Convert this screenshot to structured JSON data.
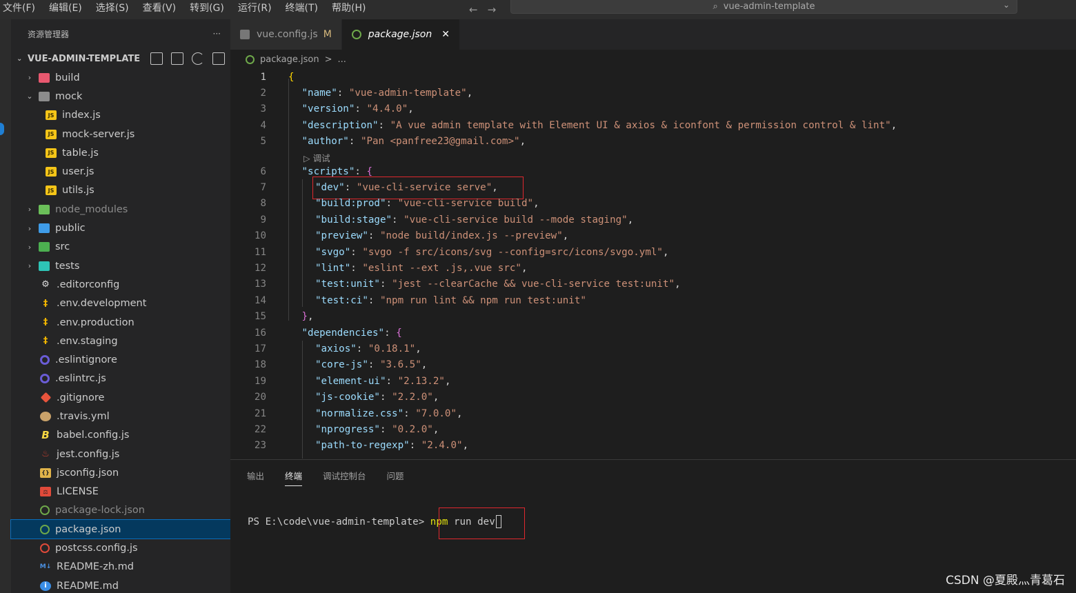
{
  "menubar": {
    "items": [
      "文件(F)",
      "编辑(E)",
      "选择(S)",
      "查看(V)",
      "转到(G)",
      "运行(R)",
      "终端(T)",
      "帮助(H)"
    ],
    "search_text": "vue-admin-template"
  },
  "sidebar": {
    "header": "资源管理器",
    "more": "···",
    "project": "VUE-ADMIN-TEMPLATE",
    "tree": [
      {
        "label": "build",
        "type": "folder",
        "expanded": false,
        "level": 0,
        "icon": "folder-red"
      },
      {
        "label": "mock",
        "type": "folder",
        "expanded": true,
        "level": 0,
        "icon": "folder-grey"
      },
      {
        "label": "index.js",
        "type": "file",
        "level": 1,
        "icon": "js"
      },
      {
        "label": "mock-server.js",
        "type": "file",
        "level": 1,
        "icon": "js"
      },
      {
        "label": "table.js",
        "type": "file",
        "level": 1,
        "icon": "js"
      },
      {
        "label": "user.js",
        "type": "file",
        "level": 1,
        "icon": "js"
      },
      {
        "label": "utils.js",
        "type": "file",
        "level": 1,
        "icon": "js"
      },
      {
        "label": "node_modules",
        "type": "folder",
        "expanded": false,
        "level": 0,
        "icon": "folder-green",
        "dim": true
      },
      {
        "label": "public",
        "type": "folder",
        "expanded": false,
        "level": 0,
        "icon": "folder-blue"
      },
      {
        "label": "src",
        "type": "folder",
        "expanded": false,
        "level": 0,
        "icon": "folder-src"
      },
      {
        "label": "tests",
        "type": "folder",
        "expanded": false,
        "level": 0,
        "icon": "folder-tests"
      },
      {
        "label": ".editorconfig",
        "type": "file",
        "level": 0,
        "icon": "gear"
      },
      {
        "label": ".env.development",
        "type": "file",
        "level": 0,
        "icon": "env"
      },
      {
        "label": ".env.production",
        "type": "file",
        "level": 0,
        "icon": "env"
      },
      {
        "label": ".env.staging",
        "type": "file",
        "level": 0,
        "icon": "env"
      },
      {
        "label": ".eslintignore",
        "type": "file",
        "level": 0,
        "icon": "eslint"
      },
      {
        "label": ".eslintrc.js",
        "type": "file",
        "level": 0,
        "icon": "eslint"
      },
      {
        "label": ".gitignore",
        "type": "file",
        "level": 0,
        "icon": "git"
      },
      {
        "label": ".travis.yml",
        "type": "file",
        "level": 0,
        "icon": "travis"
      },
      {
        "label": "babel.config.js",
        "type": "file",
        "level": 0,
        "icon": "babel"
      },
      {
        "label": "jest.config.js",
        "type": "file",
        "level": 0,
        "icon": "jest"
      },
      {
        "label": "jsconfig.json",
        "type": "file",
        "level": 0,
        "icon": "jsonc"
      },
      {
        "label": "LICENSE",
        "type": "file",
        "level": 0,
        "icon": "license"
      },
      {
        "label": "package-lock.json",
        "type": "file",
        "level": 0,
        "icon": "node",
        "dim": true
      },
      {
        "label": "package.json",
        "type": "file",
        "level": 0,
        "icon": "node",
        "active": true
      },
      {
        "label": "postcss.config.js",
        "type": "file",
        "level": 0,
        "icon": "postcss"
      },
      {
        "label": "README-zh.md",
        "type": "file",
        "level": 0,
        "icon": "md"
      },
      {
        "label": "README.md",
        "type": "file",
        "level": 0,
        "icon": "info"
      }
    ]
  },
  "tabs": [
    {
      "label": "vue.config.js",
      "modified": "M",
      "active": false
    },
    {
      "label": "package.json",
      "close": "✕",
      "active": true
    }
  ],
  "breadcrumb": {
    "file": "package.json",
    "sep": ">",
    "rest": "..."
  },
  "editor": {
    "codelens": "▷ 调试",
    "lines": [
      {
        "n": "1",
        "indent": 0,
        "tokens": [
          [
            "b1",
            "{"
          ]
        ]
      },
      {
        "n": "2",
        "indent": 1,
        "tokens": [
          [
            "k",
            "\"name\""
          ],
          [
            "p",
            ": "
          ],
          [
            "s",
            "\"vue-admin-template\""
          ],
          [
            "p",
            ","
          ]
        ]
      },
      {
        "n": "3",
        "indent": 1,
        "tokens": [
          [
            "k",
            "\"version\""
          ],
          [
            "p",
            ": "
          ],
          [
            "s",
            "\"4.4.0\""
          ],
          [
            "p",
            ","
          ]
        ]
      },
      {
        "n": "4",
        "indent": 1,
        "tokens": [
          [
            "k",
            "\"description\""
          ],
          [
            "p",
            ": "
          ],
          [
            "s",
            "\"A vue admin template with Element UI & axios & iconfont & permission control & lint\""
          ],
          [
            "p",
            ","
          ]
        ]
      },
      {
        "n": "5",
        "indent": 1,
        "tokens": [
          [
            "k",
            "\"author\""
          ],
          [
            "p",
            ": "
          ],
          [
            "s",
            "\"Pan <panfree23@gmail.com>\""
          ],
          [
            "p",
            ","
          ]
        ]
      },
      {
        "n": "6",
        "indent": 1,
        "tokens": [
          [
            "k",
            "\"scripts\""
          ],
          [
            "p",
            ": "
          ],
          [
            "b2",
            "{"
          ]
        ]
      },
      {
        "n": "7",
        "indent": 2,
        "tokens": [
          [
            "k",
            "\"dev\""
          ],
          [
            "p",
            ": "
          ],
          [
            "s",
            "\"vue-cli-service serve\""
          ],
          [
            "p",
            ","
          ]
        ]
      },
      {
        "n": "8",
        "indent": 2,
        "tokens": [
          [
            "k",
            "\"build:prod\""
          ],
          [
            "p",
            ": "
          ],
          [
            "s",
            "\"vue-cli-service build\""
          ],
          [
            "p",
            ","
          ]
        ]
      },
      {
        "n": "9",
        "indent": 2,
        "tokens": [
          [
            "k",
            "\"build:stage\""
          ],
          [
            "p",
            ": "
          ],
          [
            "s",
            "\"vue-cli-service build --mode staging\""
          ],
          [
            "p",
            ","
          ]
        ]
      },
      {
        "n": "10",
        "indent": 2,
        "tokens": [
          [
            "k",
            "\"preview\""
          ],
          [
            "p",
            ": "
          ],
          [
            "s",
            "\"node build/index.js --preview\""
          ],
          [
            "p",
            ","
          ]
        ]
      },
      {
        "n": "11",
        "indent": 2,
        "tokens": [
          [
            "k",
            "\"svgo\""
          ],
          [
            "p",
            ": "
          ],
          [
            "s",
            "\"svgo -f src/icons/svg --config=src/icons/svgo.yml\""
          ],
          [
            "p",
            ","
          ]
        ]
      },
      {
        "n": "12",
        "indent": 2,
        "tokens": [
          [
            "k",
            "\"lint\""
          ],
          [
            "p",
            ": "
          ],
          [
            "s",
            "\"eslint --ext .js,.vue src\""
          ],
          [
            "p",
            ","
          ]
        ]
      },
      {
        "n": "13",
        "indent": 2,
        "tokens": [
          [
            "k",
            "\"test:unit\""
          ],
          [
            "p",
            ": "
          ],
          [
            "s",
            "\"jest --clearCache && vue-cli-service test:unit\""
          ],
          [
            "p",
            ","
          ]
        ]
      },
      {
        "n": "14",
        "indent": 2,
        "tokens": [
          [
            "k",
            "\"test:ci\""
          ],
          [
            "p",
            ": "
          ],
          [
            "s",
            "\"npm run lint && npm run test:unit\""
          ]
        ]
      },
      {
        "n": "15",
        "indent": 1,
        "tokens": [
          [
            "b2",
            "}"
          ],
          [
            "p",
            ","
          ]
        ]
      },
      {
        "n": "16",
        "indent": 1,
        "tokens": [
          [
            "k",
            "\"dependencies\""
          ],
          [
            "p",
            ": "
          ],
          [
            "b2",
            "{"
          ]
        ]
      },
      {
        "n": "17",
        "indent": 2,
        "tokens": [
          [
            "k",
            "\"axios\""
          ],
          [
            "p",
            ": "
          ],
          [
            "s",
            "\"0.18.1\""
          ],
          [
            "p",
            ","
          ]
        ]
      },
      {
        "n": "18",
        "indent": 2,
        "tokens": [
          [
            "k",
            "\"core-js\""
          ],
          [
            "p",
            ": "
          ],
          [
            "s",
            "\"3.6.5\""
          ],
          [
            "p",
            ","
          ]
        ]
      },
      {
        "n": "19",
        "indent": 2,
        "tokens": [
          [
            "k",
            "\"element-ui\""
          ],
          [
            "p",
            ": "
          ],
          [
            "s",
            "\"2.13.2\""
          ],
          [
            "p",
            ","
          ]
        ]
      },
      {
        "n": "20",
        "indent": 2,
        "tokens": [
          [
            "k",
            "\"js-cookie\""
          ],
          [
            "p",
            ": "
          ],
          [
            "s",
            "\"2.2.0\""
          ],
          [
            "p",
            ","
          ]
        ]
      },
      {
        "n": "21",
        "indent": 2,
        "tokens": [
          [
            "k",
            "\"normalize.css\""
          ],
          [
            "p",
            ": "
          ],
          [
            "s",
            "\"7.0.0\""
          ],
          [
            "p",
            ","
          ]
        ]
      },
      {
        "n": "22",
        "indent": 2,
        "tokens": [
          [
            "k",
            "\"nprogress\""
          ],
          [
            "p",
            ": "
          ],
          [
            "s",
            "\"0.2.0\""
          ],
          [
            "p",
            ","
          ]
        ]
      },
      {
        "n": "23",
        "indent": 2,
        "tokens": [
          [
            "k",
            "\"path-to-regexp\""
          ],
          [
            "p",
            ": "
          ],
          [
            "s",
            "\"2.4.0\""
          ],
          [
            "p",
            ","
          ]
        ]
      }
    ]
  },
  "panel": {
    "tabs": [
      "输出",
      "终端",
      "调试控制台",
      "问题"
    ],
    "active_tab": "终端",
    "prompt": "PS E:\\code\\vue-admin-template> ",
    "command_word": "npm",
    "command_rest": " run dev"
  },
  "watermark": "CSDN @夏殿灬青葛石",
  "colors": {
    "highlight_box": "#e0282e",
    "active_row": "#04395e",
    "string": "#ce9178",
    "key": "#9cdcfe"
  }
}
